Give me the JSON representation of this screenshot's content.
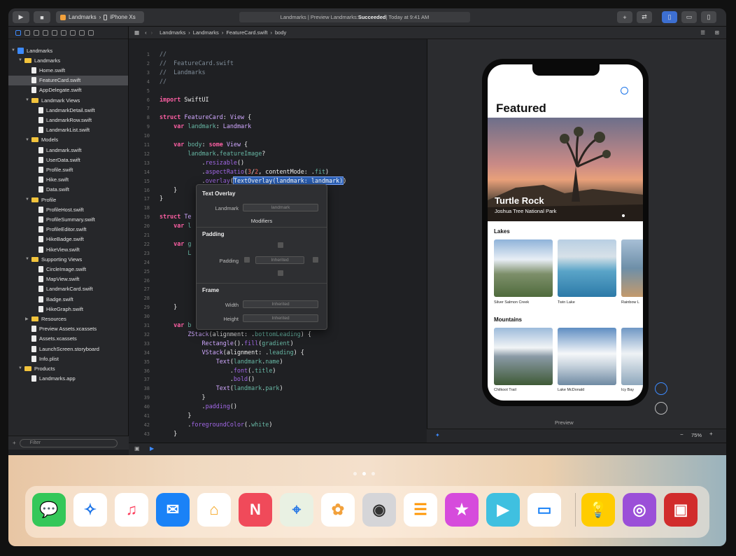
{
  "toolbar": {
    "scheme_target": "Landmarks",
    "scheme_device": "iPhone Xs",
    "status_prefix": "Landmarks | Preview Landmarks: ",
    "status_result": "Succeeded",
    "status_time": " | Today at 9:41 AM"
  },
  "navigator": {
    "rows": [
      {
        "label": "Landmarks",
        "kind": "project",
        "indent": 0
      },
      {
        "label": "Landmarks",
        "kind": "folder",
        "indent": 1
      },
      {
        "label": "Home.swift",
        "kind": "file",
        "indent": 2
      },
      {
        "label": "FeatureCard.swift",
        "kind": "file",
        "indent": 2,
        "selected": true
      },
      {
        "label": "AppDelegate.swift",
        "kind": "file",
        "indent": 2
      },
      {
        "label": "Landmark Views",
        "kind": "folder",
        "indent": 2
      },
      {
        "label": "LandmarkDetail.swift",
        "kind": "file",
        "indent": 3
      },
      {
        "label": "LandmarkRow.swift",
        "kind": "file",
        "indent": 3
      },
      {
        "label": "LandmarkList.swift",
        "kind": "file",
        "indent": 3
      },
      {
        "label": "Models",
        "kind": "folder",
        "indent": 2
      },
      {
        "label": "Landmark.swift",
        "kind": "file",
        "indent": 3
      },
      {
        "label": "UserData.swift",
        "kind": "file",
        "indent": 3
      },
      {
        "label": "Profile.swift",
        "kind": "file",
        "indent": 3
      },
      {
        "label": "Hike.swift",
        "kind": "file",
        "indent": 3
      },
      {
        "label": "Data.swift",
        "kind": "file",
        "indent": 3
      },
      {
        "label": "Profile",
        "kind": "folder",
        "indent": 2
      },
      {
        "label": "ProfileHost.swift",
        "kind": "file",
        "indent": 3
      },
      {
        "label": "ProfileSummary.swift",
        "kind": "file",
        "indent": 3
      },
      {
        "label": "ProfileEditor.swift",
        "kind": "file",
        "indent": 3
      },
      {
        "label": "HikeBadge.swift",
        "kind": "file",
        "indent": 3
      },
      {
        "label": "HikeView.swift",
        "kind": "file",
        "indent": 3
      },
      {
        "label": "Supporting Views",
        "kind": "folder",
        "indent": 2
      },
      {
        "label": "CircleImage.swift",
        "kind": "file",
        "indent": 3
      },
      {
        "label": "MapView.swift",
        "kind": "file",
        "indent": 3
      },
      {
        "label": "LandmarkCard.swift",
        "kind": "file",
        "indent": 3
      },
      {
        "label": "Badge.swift",
        "kind": "file",
        "indent": 3
      },
      {
        "label": "HikeGraph.swift",
        "kind": "file",
        "indent": 3
      },
      {
        "label": "Resources",
        "kind": "folder",
        "indent": 2,
        "collapsed": true
      },
      {
        "label": "Preview Assets.xcassets",
        "kind": "file",
        "indent": 2
      },
      {
        "label": "Assets.xcassets",
        "kind": "file",
        "indent": 2
      },
      {
        "label": "LaunchScreen.storyboard",
        "kind": "file",
        "indent": 2
      },
      {
        "label": "Info.plist",
        "kind": "file",
        "indent": 2
      },
      {
        "label": "Products",
        "kind": "folder",
        "indent": 1
      },
      {
        "label": "Landmarks.app",
        "kind": "file",
        "indent": 2
      }
    ],
    "filter_placeholder": "Filter"
  },
  "jumpbar": {
    "crumbs": [
      "Landmarks",
      "Landmarks",
      "FeatureCard.swift",
      "body"
    ]
  },
  "editor": {
    "line_numbers": [
      "1",
      "2",
      "3",
      "4",
      "5",
      "6",
      "7",
      "8",
      "9",
      "10",
      "11",
      "12",
      "13",
      "14",
      "15",
      "16",
      "17",
      "18",
      "19",
      "20",
      "21",
      "22",
      "23",
      "24",
      "25",
      "26",
      "27",
      "28",
      "29",
      "30",
      "31",
      "32",
      "33",
      "34",
      "35",
      "36",
      "37",
      "38",
      "39",
      "40",
      "41",
      "42",
      "43"
    ]
  },
  "popover": {
    "title": "Text Overlay",
    "landmark_label": "Landmark",
    "landmark_value": "landmark",
    "modifiers_label": "Modifiers",
    "padding_title": "Padding",
    "padding_label": "Padding",
    "padding_value": "Inherited",
    "frame_title": "Frame",
    "width_label": "Width",
    "width_value": "Inherited",
    "height_label": "Height",
    "height_value": "Inherited"
  },
  "preview": {
    "screen_title": "Featured",
    "hero_title": "Turtle Rock",
    "hero_subtitle": "Joshua Tree National Park",
    "section_lakes": "Lakes",
    "lakes": [
      "Silver Salmon Creek",
      "Twin Lake",
      "Rainbow L"
    ],
    "section_mountains": "Mountains",
    "mountains": [
      "Chilkoot Trail",
      "Lake McDonald",
      "Icy Bay"
    ],
    "caption": "Preview",
    "zoom": "75%"
  },
  "dock": {
    "apps": [
      "Messages",
      "Safari",
      "Music",
      "Mail",
      "Home",
      "News",
      "Maps",
      "Photos",
      "Camera",
      "Reminders",
      "iTunes Store",
      "Clips",
      "Files",
      "Tips",
      "Podcasts",
      "Photo Booth"
    ],
    "page_index": 2,
    "page_count": 3
  }
}
